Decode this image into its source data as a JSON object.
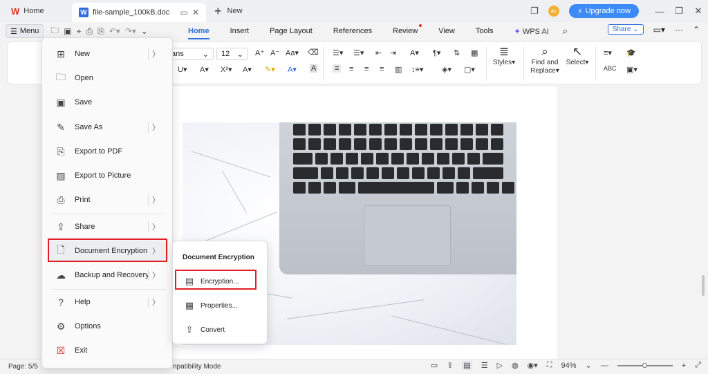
{
  "titlebar": {
    "home_tab": "Home",
    "doc_tab": "file-sample_100kB.doc",
    "doc_badge": "W",
    "new_tab": "New",
    "avatar_initials": "Ac",
    "upgrade": "Upgrade now"
  },
  "menurow": {
    "menu_label": "Menu",
    "tabs": [
      "Home",
      "Insert",
      "Page Layout",
      "References",
      "Review",
      "View",
      "Tools"
    ],
    "wps_ai": "WPS AI",
    "share": "Share"
  },
  "ribbon": {
    "font_name_partial": "ans",
    "font_size": "12",
    "styles": "Styles",
    "find_replace_1": "Find and",
    "find_replace_2": "Replace",
    "select": "Select"
  },
  "file_menu": {
    "items": [
      {
        "label": "New",
        "icon": "new-icon",
        "has_sub": true
      },
      {
        "label": "Open",
        "icon": "open-icon",
        "has_sub": false
      },
      {
        "label": "Save",
        "icon": "save-icon",
        "has_sub": false
      },
      {
        "label": "Save As",
        "icon": "save-as-icon",
        "has_sub": true
      },
      {
        "label": "Export to PDF",
        "icon": "pdf-icon",
        "has_sub": false
      },
      {
        "label": "Export to Picture",
        "icon": "picture-icon",
        "has_sub": false
      },
      {
        "label": "Print",
        "icon": "print-icon",
        "has_sub": true
      },
      {
        "label": "Share",
        "icon": "share-icon",
        "has_sub": true
      },
      {
        "label": "Document Encryption",
        "icon": "encryption-icon",
        "has_sub": true
      },
      {
        "label": "Backup and Recovery",
        "icon": "backup-icon",
        "has_sub": true
      },
      {
        "label": "Help",
        "icon": "help-icon",
        "has_sub": true
      },
      {
        "label": "Options",
        "icon": "options-icon",
        "has_sub": false
      },
      {
        "label": "Exit",
        "icon": "exit-icon",
        "has_sub": false
      }
    ]
  },
  "submenu": {
    "title": "Document Encryption",
    "items": [
      "Encryption...",
      "Properties...",
      "Convert"
    ]
  },
  "statusbar": {
    "page": "Page: 5/5",
    "mode_partial": "npatibility Mode",
    "zoom": "94%",
    "zoom_fraction": 0.5
  },
  "colors": {
    "accent": "#2f6de1",
    "highlight_box": "#e01e25",
    "upgrade_bg": "#3d8bf8"
  }
}
